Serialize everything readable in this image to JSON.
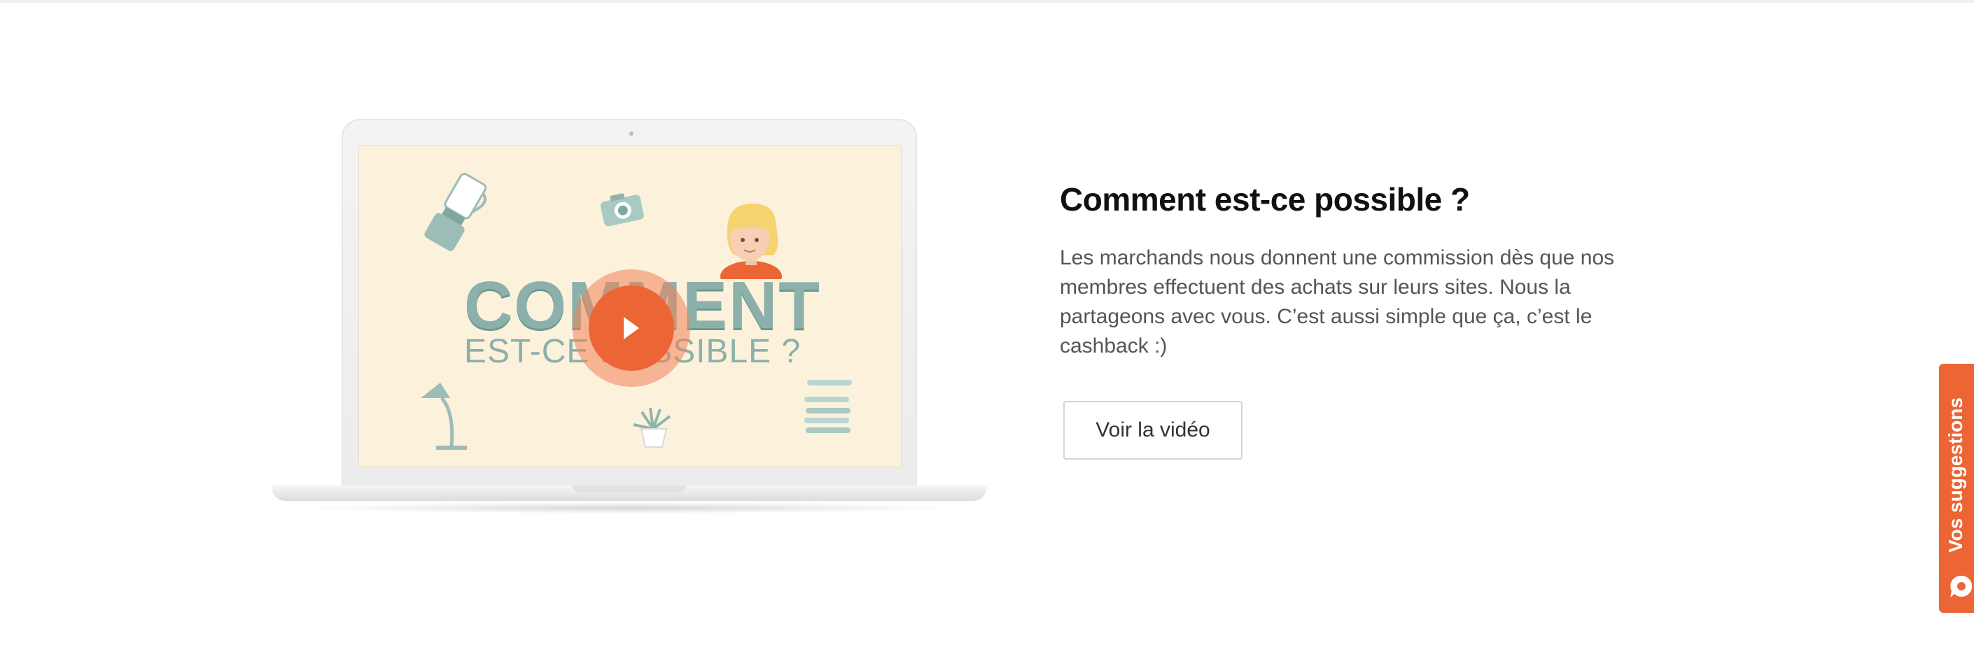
{
  "video_card": {
    "screen_title_line1": "COMMENT",
    "screen_title_line2": "EST-CE POSSIBLE ?",
    "play_icon": "play-icon",
    "colors": {
      "screen_bg": "#fcf2dc",
      "play": "#ec6534",
      "title": "#8cb0aa"
    }
  },
  "content": {
    "heading": "Comment est-ce possible ?",
    "description": "Les marchands nous donnent une commission dès que nos membres effectuent des achats sur leurs sites. Nous la partageons avec vous. C’est aussi simple que ça, c’est le cashback :)",
    "button_label": "Voir la vidéo"
  },
  "feedback_tab": {
    "label": "Vos suggestions",
    "icon": "chat-bubble-icon",
    "color": "#ec6534"
  }
}
